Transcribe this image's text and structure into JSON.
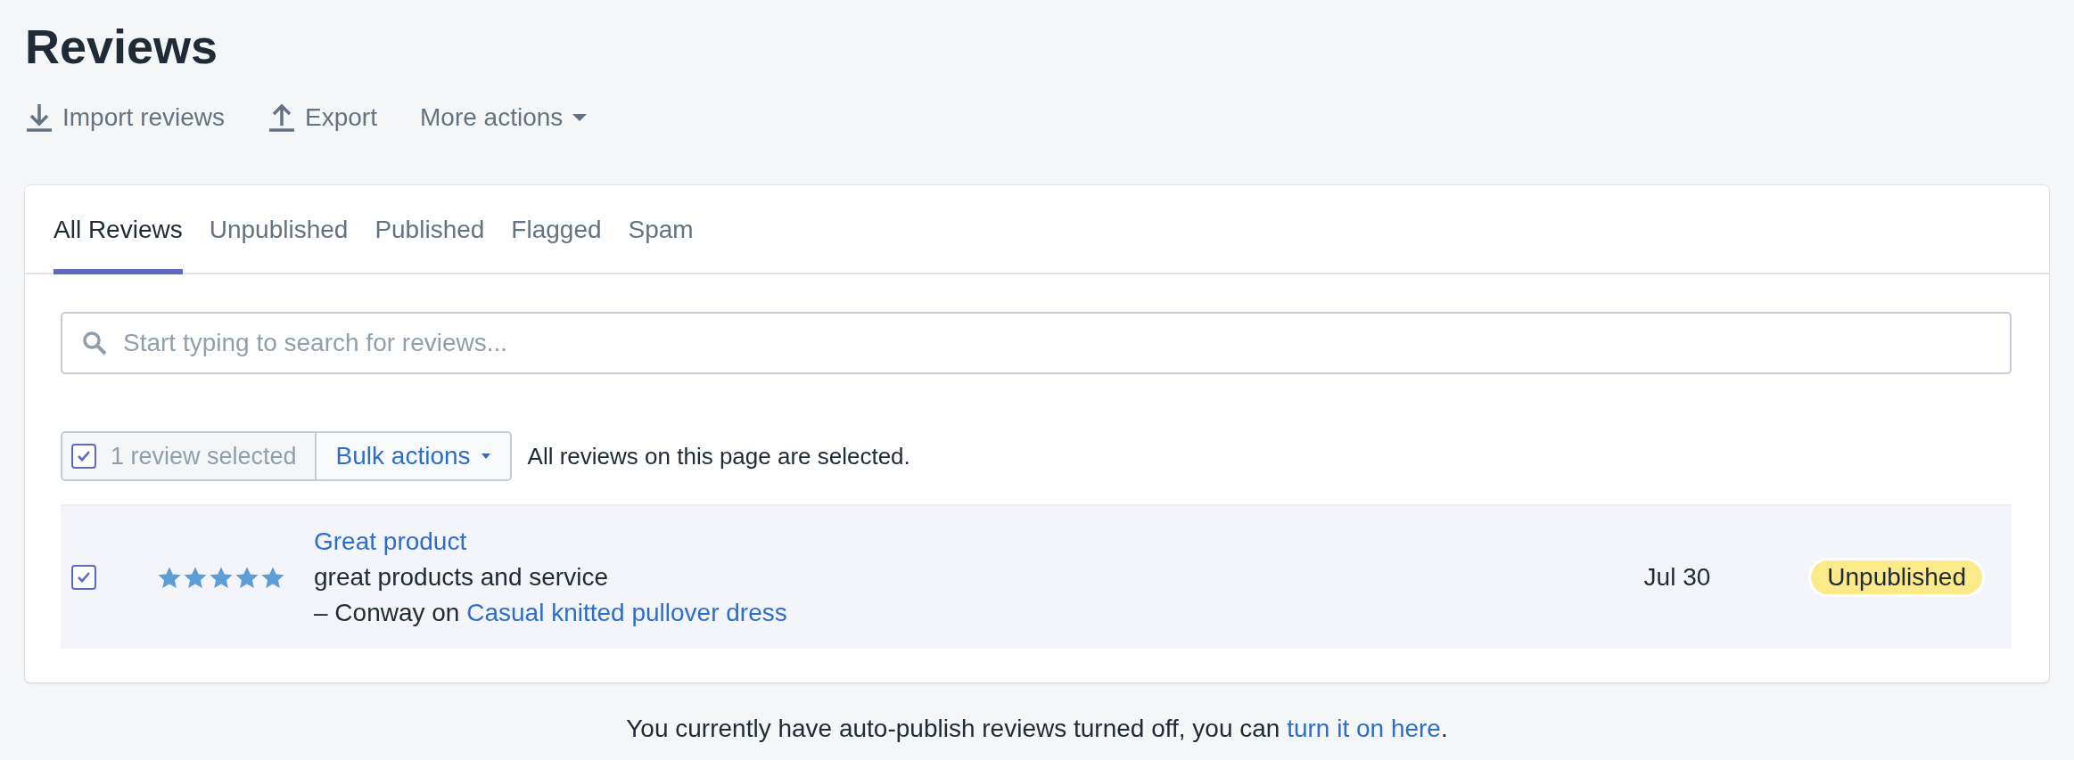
{
  "page": {
    "title": "Reviews"
  },
  "actions": [
    {
      "kind": "import",
      "label": "Import reviews"
    },
    {
      "kind": "export",
      "label": "Export"
    },
    {
      "kind": "more",
      "label": "More actions"
    }
  ],
  "tabs": [
    {
      "label": "All Reviews",
      "selected": true
    },
    {
      "label": "Unpublished",
      "selected": false
    },
    {
      "label": "Published",
      "selected": false
    },
    {
      "label": "Flagged",
      "selected": false
    },
    {
      "label": "Spam",
      "selected": false
    }
  ],
  "search": {
    "placeholder": "Start typing to search for reviews..."
  },
  "bulk_bar": {
    "checked": true,
    "count_label": "1 review selected",
    "bulk_button": "Bulk actions",
    "note": "All reviews on this page are selected."
  },
  "reviews": [
    {
      "selected": true,
      "stars": 5,
      "title": "Great product",
      "body": "great products and service",
      "byline": "– Conway on",
      "product": "Casual knitted pullover dress",
      "date": "Jul 30",
      "status": "Unpublished"
    }
  ],
  "footer": {
    "text": "You currently have auto-publish reviews turned off, you can",
    "link": "turn it on here",
    "end": "."
  }
}
